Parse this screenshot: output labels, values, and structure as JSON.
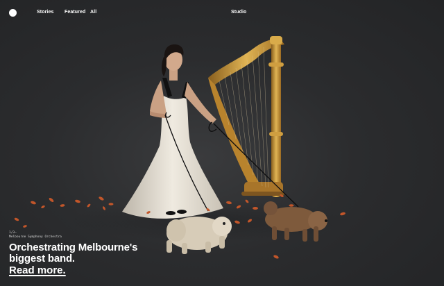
{
  "nav": {
    "logo": "",
    "links": [
      "Stories",
      "Featured",
      "All"
    ],
    "studio": "Studio"
  },
  "hero": {
    "counter": "1/3—",
    "client": "Melbourne Symphony Orchestra",
    "headline_line1": "Orchestrating Melbourne's",
    "headline_line2": "biggest band.",
    "cta": "Read more."
  },
  "colors": {
    "background": "#2a2b2d",
    "text": "#ffffff",
    "harp_gold": "#c99a3a",
    "dress": "#e8e2d6",
    "leaf": "#c2562a"
  }
}
